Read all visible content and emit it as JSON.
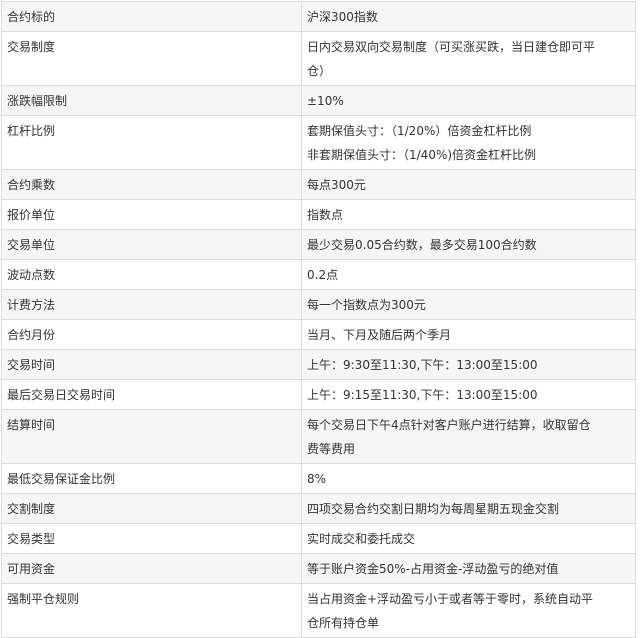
{
  "rows": [
    {
      "label": "合约标的",
      "value": [
        "沪深300指数"
      ]
    },
    {
      "label": "交易制度",
      "value": [
        "日内交易双向交易制度（可买涨买跌，当日建仓即可平",
        "仓）"
      ]
    },
    {
      "label": "涨跌幅限制",
      "value": [
        "±10%"
      ]
    },
    {
      "label": "杠杆比例",
      "value": [
        "套期保值头寸：（1/20%）倍资金杠杆比例",
        "非套期保值头寸：（1/40%)倍资金杠杆比例"
      ]
    },
    {
      "label": "合约乘数",
      "value": [
        "每点300元"
      ]
    },
    {
      "label": "报价单位",
      "value": [
        "指数点"
      ]
    },
    {
      "label": "交易单位",
      "value": [
        "最少交易0.05合约数，最多交易100合约数"
      ]
    },
    {
      "label": "波动点数",
      "value": [
        "0.2点"
      ]
    },
    {
      "label": "计费方法",
      "value": [
        "每一个指数点为300元"
      ]
    },
    {
      "label": "合约月份",
      "value": [
        "当月、下月及随后两个季月"
      ]
    },
    {
      "label": "交易时间",
      "value": [
        "上午：9:30至11:30,下午：13:00至15:00"
      ]
    },
    {
      "label": "最后交易日交易时间",
      "value": [
        "上午：9:15至11:30,下午：13:00至15:00"
      ]
    },
    {
      "label": "结算时间",
      "value": [
        "每个交易日下午4点针对客户账户进行结算，收取留仓",
        "费等费用"
      ]
    },
    {
      "label": "最低交易保证金比例",
      "value": [
        "8%"
      ]
    },
    {
      "label": "交割制度",
      "value": [
        "四项交易合约交割日期均为每周星期五现金交割"
      ]
    },
    {
      "label": "交易类型",
      "value": [
        "实时成交和委托成交"
      ]
    },
    {
      "label": "可用资金",
      "value": [
        "等于账户资金50%-占用资金-浮动盈亏的绝对值"
      ]
    },
    {
      "label": "强制平仓规则",
      "value": [
        "当占用资金+浮动盈亏小于或者等于零时，系统自动平",
        "仓所有持仓单"
      ]
    }
  ]
}
